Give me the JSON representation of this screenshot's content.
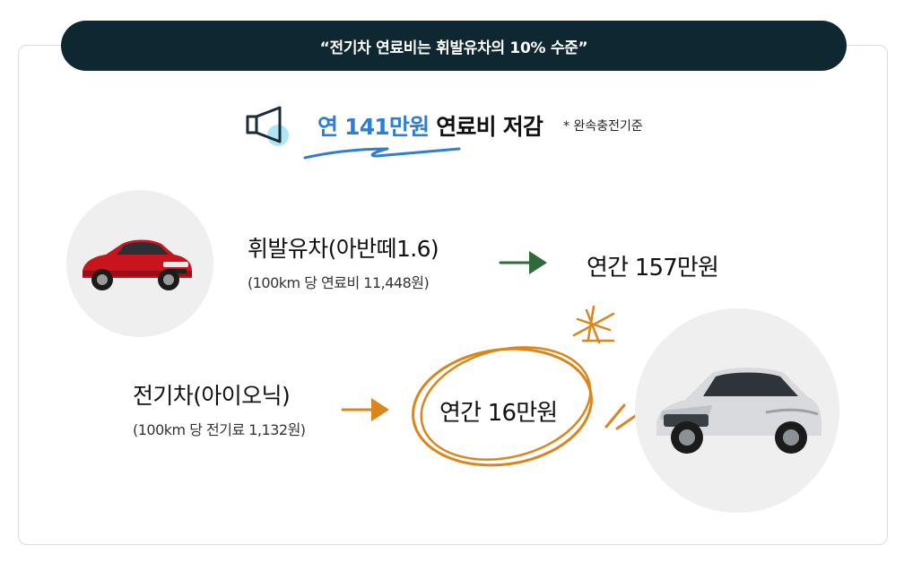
{
  "banner": {
    "text": "“전기차 연료비는 휘발유차의 10% 수준”",
    "color": "#0e2730"
  },
  "headline": {
    "highlight": "연 141만원",
    "rest": " 연료비 저감",
    "note": "* 완속충전기준",
    "highlight_color": "#2e7fd4"
  },
  "gasoline": {
    "title": "휘발유차(아반떼1.6)",
    "detail": "(100km 당 연료비 11,448원)",
    "annual": "연간 157만원",
    "arrow_color": "#2f6b3a"
  },
  "electric": {
    "title": "전기차(아이오닉)",
    "detail": "(100km 당 전기료 1,132원)",
    "annual": "연간 16만원",
    "arrow_color": "#d9861c"
  },
  "icons": {
    "megaphone": "megaphone-icon",
    "red_car": "red-sedan-image",
    "white_car": "white-hatchback-image",
    "star": "hand-drawn-star-icon"
  }
}
